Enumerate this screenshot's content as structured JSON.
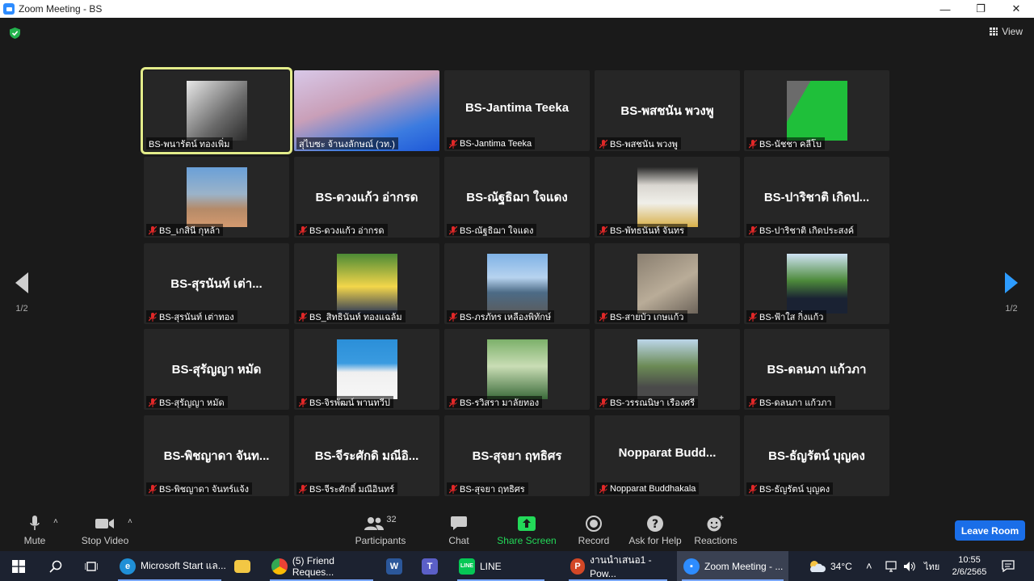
{
  "window": {
    "title": "Zoom Meeting - BS",
    "controls": [
      "—",
      "❐",
      "✕"
    ]
  },
  "view_label": "View",
  "pager": {
    "left": "1/2",
    "right": "1/2"
  },
  "participants": [
    {
      "label": "BS-พนารัตน์ ทองเพิ่ม",
      "big": "",
      "media": "photo",
      "muted": false,
      "active": true
    },
    {
      "label": "สุไบซะ จ้านงลักษณ์ (วท.)",
      "big": "",
      "media": "video",
      "muted": false,
      "active": false
    },
    {
      "label": "BS-Jantima Teeka",
      "big": "BS-Jantima Teeka",
      "media": "none",
      "muted": true,
      "active": false
    },
    {
      "label": "BS-พสชนัน พวงพู",
      "big": "BS-พสชนัน พวงพู",
      "media": "none",
      "muted": true,
      "active": false
    },
    {
      "label": "BS-นัชชา คลีโบ",
      "big": "",
      "media": "photo",
      "muted": true,
      "active": false
    },
    {
      "label": "BS_เกสินี กุหล้า",
      "big": "",
      "media": "photo",
      "muted": true,
      "active": false
    },
    {
      "label": "BS-ดวงแก้ว อ่ากรด",
      "big": "BS-ดวงแก้ว อ่ากรด",
      "media": "none",
      "muted": true,
      "active": false
    },
    {
      "label": "BS-ณัฐธิฌา ใจแดง",
      "big": "BS-ณัฐธิฌา ใจแดง",
      "media": "none",
      "muted": true,
      "active": false
    },
    {
      "label": "BS-พัทธนันท์ จันทร",
      "big": "",
      "media": "photo",
      "muted": true,
      "active": false
    },
    {
      "label": "BS-ปาริชาติ เกิดประสงค์",
      "big": "BS-ปาริชาติ เกิดป...",
      "media": "none",
      "muted": true,
      "active": false
    },
    {
      "label": "BS-สุรนันท์   เต่าทอง",
      "big": "BS-สุรนันท์   เต่า...",
      "media": "none",
      "muted": true,
      "active": false
    },
    {
      "label": "BS_สิทธินันท์ ทองแฉล้ม",
      "big": "",
      "media": "photo",
      "muted": true,
      "active": false
    },
    {
      "label": "BS-ภรภัทร เหลืองพิทักษ์",
      "big": "",
      "media": "photo",
      "muted": true,
      "active": false
    },
    {
      "label": "BS-สายบัว เกษแก้ว",
      "big": "",
      "media": "photo",
      "muted": true,
      "active": false
    },
    {
      "label": "BS-ฟ้าใส กิ่งแก้ว",
      "big": "",
      "media": "photo",
      "muted": true,
      "active": false
    },
    {
      "label": "BS-สุรัญญา หมัด",
      "big": "BS-สุรัญญา หมัด",
      "media": "none",
      "muted": true,
      "active": false
    },
    {
      "label": "BS-จิรพัฒน์ พานทวีป",
      "big": "",
      "media": "photo",
      "muted": true,
      "active": false
    },
    {
      "label": "BS-รวิสรา มาลัยทอง",
      "big": "",
      "media": "photo",
      "muted": true,
      "active": false
    },
    {
      "label": "BS-วรรณนิษา เรืองศรี",
      "big": "",
      "media": "photo",
      "muted": true,
      "active": false
    },
    {
      "label": "BS-ดลนภา แก้วภา",
      "big": "BS-ดลนภา แก้วภา",
      "media": "none",
      "muted": true,
      "active": false
    },
    {
      "label": "BS-พิชญาดา จันทร์แจ้ง",
      "big": "BS-พิชญาดา จันท...",
      "media": "none",
      "muted": true,
      "active": false
    },
    {
      "label": "BS-จีระศักดิ์ มณีอินทร์",
      "big": "BS-จีระศักดิ มณีอิ...",
      "media": "none",
      "muted": true,
      "active": false
    },
    {
      "label": "BS-สุจยา ฤทธิศร",
      "big": "BS-สุจยา ฤทธิศร",
      "media": "none",
      "muted": true,
      "active": false
    },
    {
      "label": "Nopparat Buddhakala",
      "big": "Nopparat  Budd...",
      "media": "none",
      "muted": true,
      "active": false
    },
    {
      "label": "BS-ธัญรัตน์ บุญคง",
      "big": "BS-ธัญรัตน์ บุญคง",
      "media": "none",
      "muted": true,
      "active": false
    }
  ],
  "toolbar": {
    "mute": "Mute",
    "stop_video": "Stop Video",
    "participants": "Participants",
    "participants_count": "32",
    "chat": "Chat",
    "share_screen": "Share Screen",
    "record": "Record",
    "ask_for_help": "Ask for Help",
    "reactions": "Reactions",
    "leave_room": "Leave Room"
  },
  "taskbar": {
    "apps": [
      {
        "label": "Microsoft Start แล...",
        "icon": "edge-icon"
      },
      {
        "label": "",
        "icon": "folder-icon"
      },
      {
        "label": "(5) Friend Reques...",
        "icon": "chrome-icon"
      },
      {
        "label": "",
        "icon": "word-icon"
      },
      {
        "label": "",
        "icon": "teams-icon"
      },
      {
        "label": "LINE",
        "icon": "line-icon"
      },
      {
        "label": "งานนำเสนอ1 - Pow...",
        "icon": "powerpoint-icon"
      },
      {
        "label": "Zoom Meeting - ...",
        "icon": "zoom-icon"
      }
    ],
    "weather": "34°C",
    "lang": "ไทย",
    "time": "10:55",
    "date": "2/6/2565"
  },
  "colors": {
    "active_speaker": "#e3ec8a",
    "leave": "#1a6ee8",
    "share": "#23d959",
    "mute_red": "#e02828"
  }
}
